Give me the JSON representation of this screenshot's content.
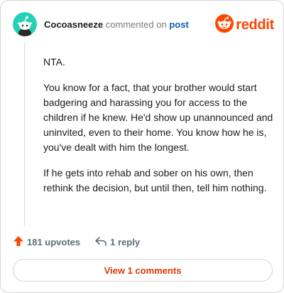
{
  "header": {
    "username": "Cocoasneeze",
    "action_text": "commented on",
    "post_link": "post",
    "logo_text": "reddit"
  },
  "comment": {
    "paragraphs": [
      "NTA.",
      "You know for a fact, that your brother would start badgering and harassing you for access to the children if he knew. He'd show up unannounced and uninvited, even to their home. You know how he is, you've dealt with him the longest.",
      "If he gets into rehab and sober on his own, then rethink the decision, but until then, tell him nothing."
    ]
  },
  "actions": {
    "upvotes": "181 upvotes",
    "replies": "1 reply"
  },
  "footer": {
    "view_button": "View 1 comments"
  },
  "colors": {
    "brand": "#ff4500",
    "link": "#0a5fb4",
    "avatar_bg": "#24d1b5",
    "view_button_text": "#d93a00"
  },
  "icons": {
    "avatar": "snoo-avatar-icon",
    "logo": "reddit-snoo-icon",
    "upvote": "upvote-arrow-icon",
    "reply": "reply-arrow-icon"
  }
}
